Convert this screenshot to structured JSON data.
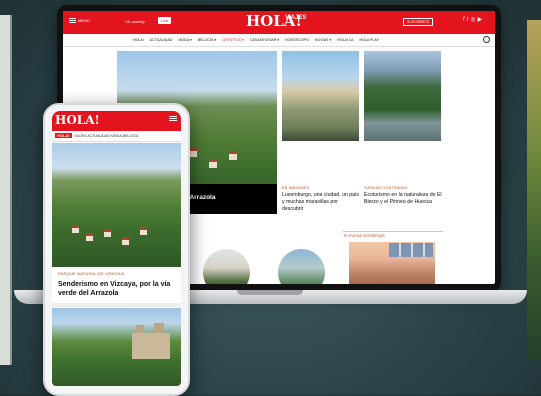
{
  "colors": {
    "brand_red": "#e3141d",
    "kicker_brown": "#b04b1e",
    "background": "#2b4347"
  },
  "laptop": {
    "topbar": {
      "menu_label": "MENÚ",
      "edition": "UK country",
      "live": "Live",
      "logo": "HOLA!",
      "logo_sub": "VIAJES",
      "subscribe": "SUSCRÍBETE",
      "social_icons": [
        "facebook-icon",
        "twitter-icon",
        "instagram-icon",
        "youtube-icon"
      ]
    },
    "nav": [
      "HOLA!",
      "ACTUALIDAD",
      "MODA ▾",
      "BELLEZA ▾",
      "LIFESTYLE ▾",
      "CASAS/HOGAR ▾",
      "HORÓSCOPO",
      "NOVIAS ▾",
      "HOLA! LA",
      "HOLA PLAY"
    ],
    "hero": {
      "title": "por la vía verde del Arrazola"
    },
    "articles": [
      {
        "kicker": "EN IMÁGENES",
        "title": "Luxemburgo, una ciudad, un país y muchas maravillas por descubrir"
      },
      {
        "kicker": "TURISMO SOSTENIBLE",
        "title": "Ecoturismo en la naturaleza de El Bierzo y el Pirineo de Huesca"
      }
    ],
    "section_title": "TE PUEDE INTERESAR"
  },
  "phone": {
    "logo": "HOLA!",
    "nav_logo": "HOLA!",
    "nav": [
      "VIAJES",
      "ACTUALIDAD",
      "MODA",
      "BELLEZA"
    ],
    "article": {
      "kicker": "PARQUE NATURAL DE URKIOLA",
      "title": "Senderismo en Vizcaya, por la vía verde del Arrazola"
    }
  }
}
